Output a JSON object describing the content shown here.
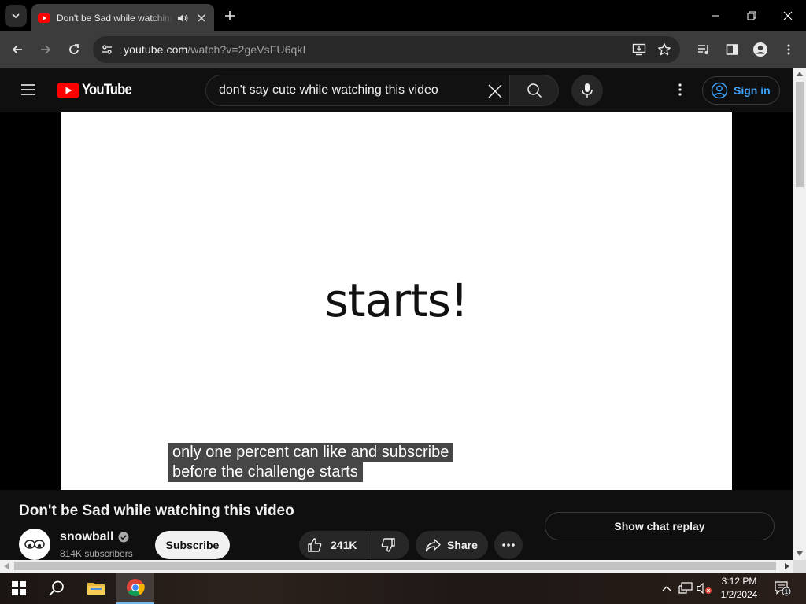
{
  "browser": {
    "tab": {
      "title": "Don't be Sad while watching this video"
    },
    "url": {
      "host": "youtube.com",
      "path": "/watch?v=2geVsFU6qkI"
    }
  },
  "youtube": {
    "logo_text": "YouTube",
    "search": {
      "query": "don't say cute while watching this video"
    },
    "sign_in_label": "Sign in"
  },
  "video": {
    "frame_text": "starts!",
    "captions": [
      "only one percent can like and subscribe",
      "before the challenge starts"
    ],
    "title": "Don't be Sad while watching this video",
    "channel": {
      "name": "snowball",
      "subscribers": "814K subscribers"
    },
    "subscribe_label": "Subscribe",
    "likes": "241K",
    "share_label": "Share",
    "chat_replay_label": "Show chat replay"
  },
  "taskbar": {
    "time": "3:12 PM",
    "date": "1/2/2024",
    "notification_count": "1"
  },
  "colors": {
    "brand_red": "#ff0000",
    "link_blue": "#3ea6ff",
    "background": "#0f0f0f"
  }
}
